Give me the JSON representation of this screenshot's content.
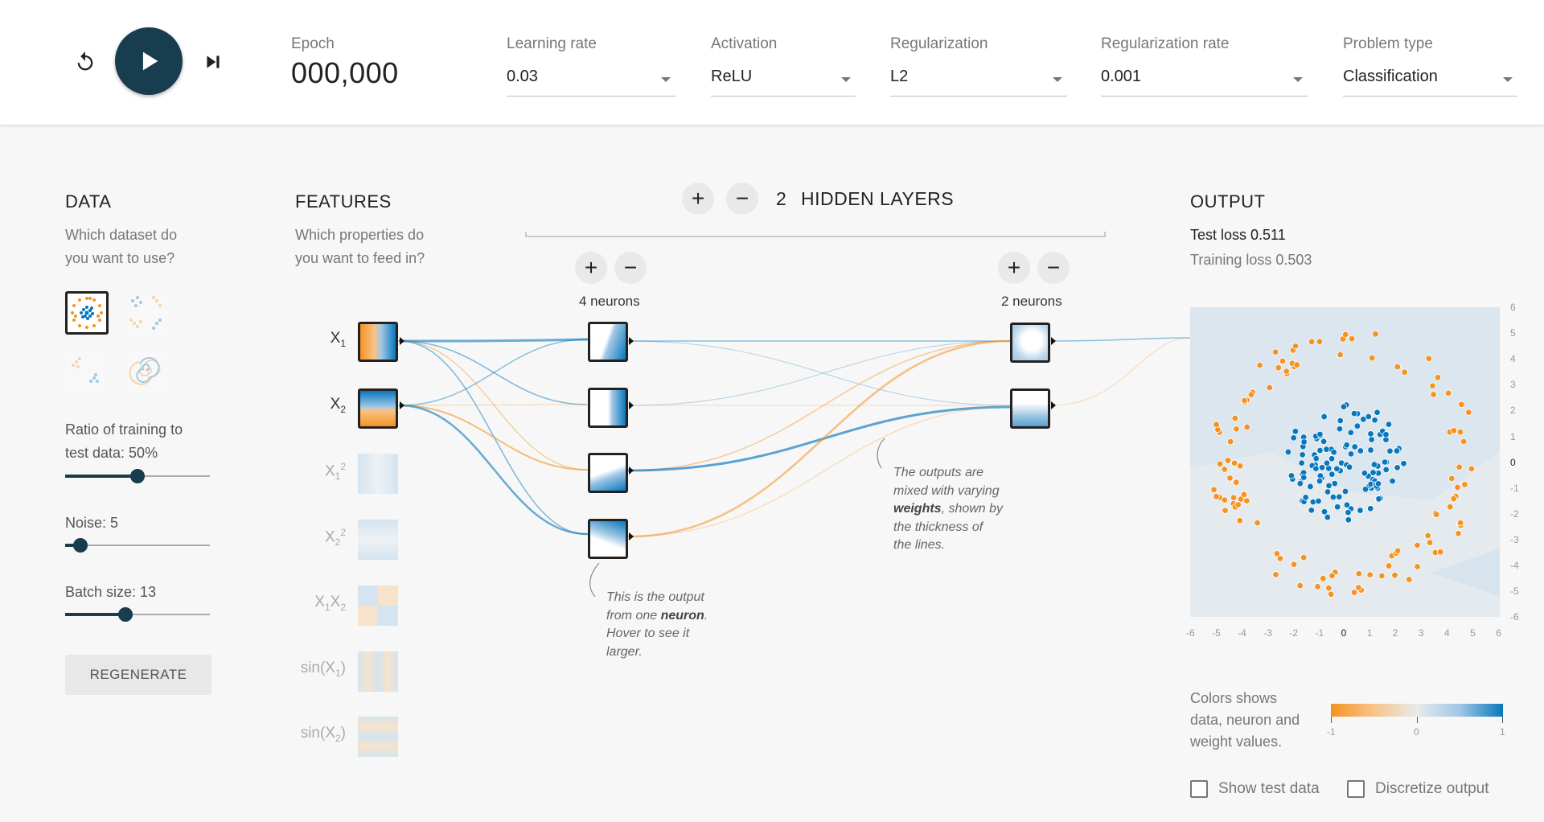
{
  "controls": {
    "reset_icon": "reset-icon",
    "play_icon": "play-icon",
    "step_icon": "step-forward-icon"
  },
  "epoch": {
    "label": "Epoch",
    "value": "000,000"
  },
  "selects": {
    "learning_rate": {
      "label": "Learning rate",
      "value": "0.03"
    },
    "activation": {
      "label": "Activation",
      "value": "ReLU"
    },
    "regularization": {
      "label": "Regularization",
      "value": "L2"
    },
    "regularization_rate": {
      "label": "Regularization rate",
      "value": "0.001"
    },
    "problem_type": {
      "label": "Problem type",
      "value": "Classification"
    }
  },
  "data_panel": {
    "title": "DATA",
    "subtitle_1": "Which dataset do",
    "subtitle_2": "you want to use?",
    "ratio_label_1": "Ratio of training to",
    "ratio_label_2": "test data:  50%",
    "ratio_value": 50,
    "noise_label": "Noise:  5",
    "noise_value": 5,
    "batch_label": "Batch size:  13",
    "batch_value": 13,
    "regenerate": "REGENERATE"
  },
  "features_panel": {
    "title": "FEATURES",
    "subtitle_1": "Which properties do",
    "subtitle_2": "you want to feed in?",
    "features": [
      {
        "label": "X",
        "sub": "1",
        "sup": "",
        "active": true
      },
      {
        "label": "X",
        "sub": "2",
        "sup": "",
        "active": true
      },
      {
        "label": "X",
        "sub": "1",
        "sup": "2",
        "active": false
      },
      {
        "label": "X",
        "sub": "2",
        "sup": "2",
        "active": false
      },
      {
        "label": "X1X2",
        "sub": "",
        "sup": "",
        "active": false
      },
      {
        "label": "sin(X1)",
        "sub": "",
        "sup": "",
        "active": false
      },
      {
        "label": "sin(X2)",
        "sub": "",
        "sup": "",
        "active": false
      }
    ]
  },
  "hidden": {
    "count": "2",
    "title": "HIDDEN LAYERS",
    "layer1_neurons": "4 neurons",
    "layer2_neurons": "2 neurons",
    "plus": "+",
    "minus": "−"
  },
  "notes": {
    "neuron_note_1": "This is the output",
    "neuron_note_2a": "from one ",
    "neuron_note_2b": "neuron",
    "neuron_note_2c": ".",
    "neuron_note_3": "Hover to see it",
    "neuron_note_4": "larger.",
    "weights_note_1": "The outputs are",
    "weights_note_2": "mixed with varying",
    "weights_note_3a": "weights",
    "weights_note_3b": ", shown by",
    "weights_note_4": "the thickness of",
    "weights_note_5": "the lines."
  },
  "output_panel": {
    "title": "OUTPUT",
    "test_loss": "Test loss 0.511",
    "training_loss": "Training loss 0.503",
    "x_ticks": [
      "-6",
      "-5",
      "-4",
      "-3",
      "-2",
      "-1",
      "0",
      "1",
      "2",
      "3",
      "4",
      "5",
      "6"
    ],
    "y_ticks": [
      "6",
      "5",
      "4",
      "3",
      "2",
      "1",
      "0",
      "-1",
      "-2",
      "-3",
      "-4",
      "-5",
      "-6"
    ],
    "legend_1": "Colors shows",
    "legend_2": "data, neuron and",
    "legend_3": "weight values.",
    "legend_ticks": [
      "-1",
      "0",
      "1"
    ],
    "show_test_data": "Show test data",
    "discretize_output": "Discretize output"
  },
  "colors": {
    "orange": "#f59322",
    "blue": "#0877bd",
    "dark": "#183d4e"
  }
}
